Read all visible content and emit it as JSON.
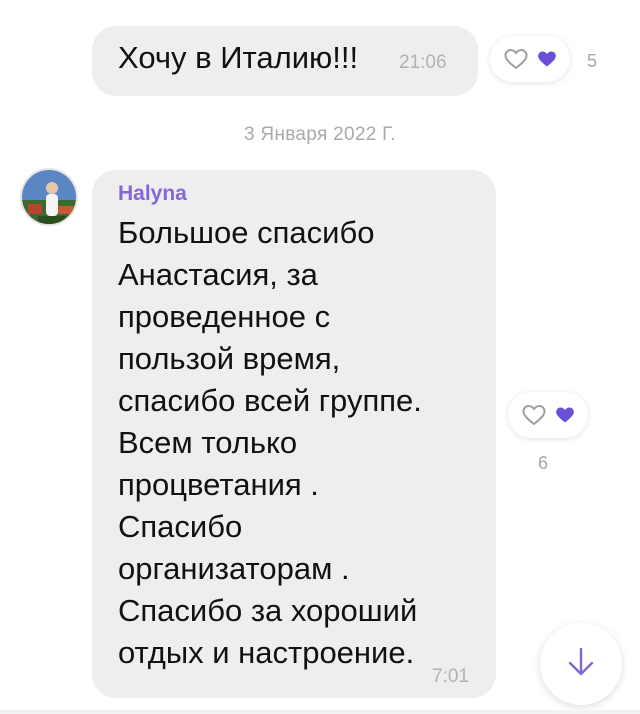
{
  "messages": [
    {
      "text": "Хочу в Италию!!!",
      "time": "21:06",
      "reactions": {
        "like_count": "5"
      }
    }
  ],
  "date_separator": "3 Января 2022 Г.",
  "incoming": {
    "sender": "Halyna",
    "lines": [
      "Большое спасибо",
      "Анастасия, за",
      "проведенное с",
      "пользой время,",
      "спасибо всей группе.",
      "Всем только",
      "процветания .",
      "Спасибо",
      "организаторам .",
      "Спасибо за хороший",
      "отдых и настроение."
    ],
    "time": "7:01",
    "reactions": {
      "like_count": "6"
    }
  },
  "colors": {
    "accent": "#8566d6",
    "bubble": "#eeeeef",
    "muted": "#b2b2b5"
  },
  "icons": [
    "heart-outline-icon",
    "heart-filled-icon",
    "chevron-down-icon",
    "avatar"
  ]
}
